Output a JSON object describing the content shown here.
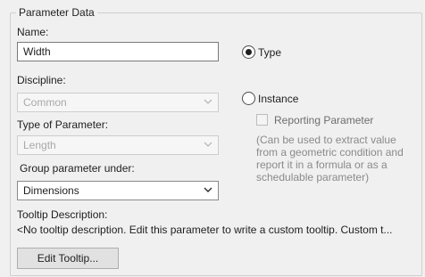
{
  "group": {
    "title": "Parameter Data"
  },
  "name": {
    "label": "Name:",
    "value": "Width"
  },
  "discipline": {
    "label": "Discipline:",
    "value": "Common"
  },
  "type_of_parameter": {
    "label": "Type of Parameter:",
    "value": "Length"
  },
  "group_under": {
    "label": "Group parameter under:",
    "value": "Dimensions"
  },
  "kind": {
    "type_label": "Type",
    "instance_label": "Instance",
    "selected": "Type"
  },
  "reporting": {
    "label": "Reporting Parameter",
    "hint": "(Can be used to extract value from a geometric condition and report it in a formula or as a schedulable parameter)"
  },
  "tooltip": {
    "label": "Tooltip Description:",
    "text": "<No tooltip description. Edit this parameter to write a custom tooltip. Custom t...",
    "edit_button": "Edit Tooltip..."
  },
  "icons": {
    "dropdown": "chevron-down-icon"
  },
  "colors": {
    "disabled_text": "#a9a9a9",
    "hint_text": "#8a8a8a"
  }
}
